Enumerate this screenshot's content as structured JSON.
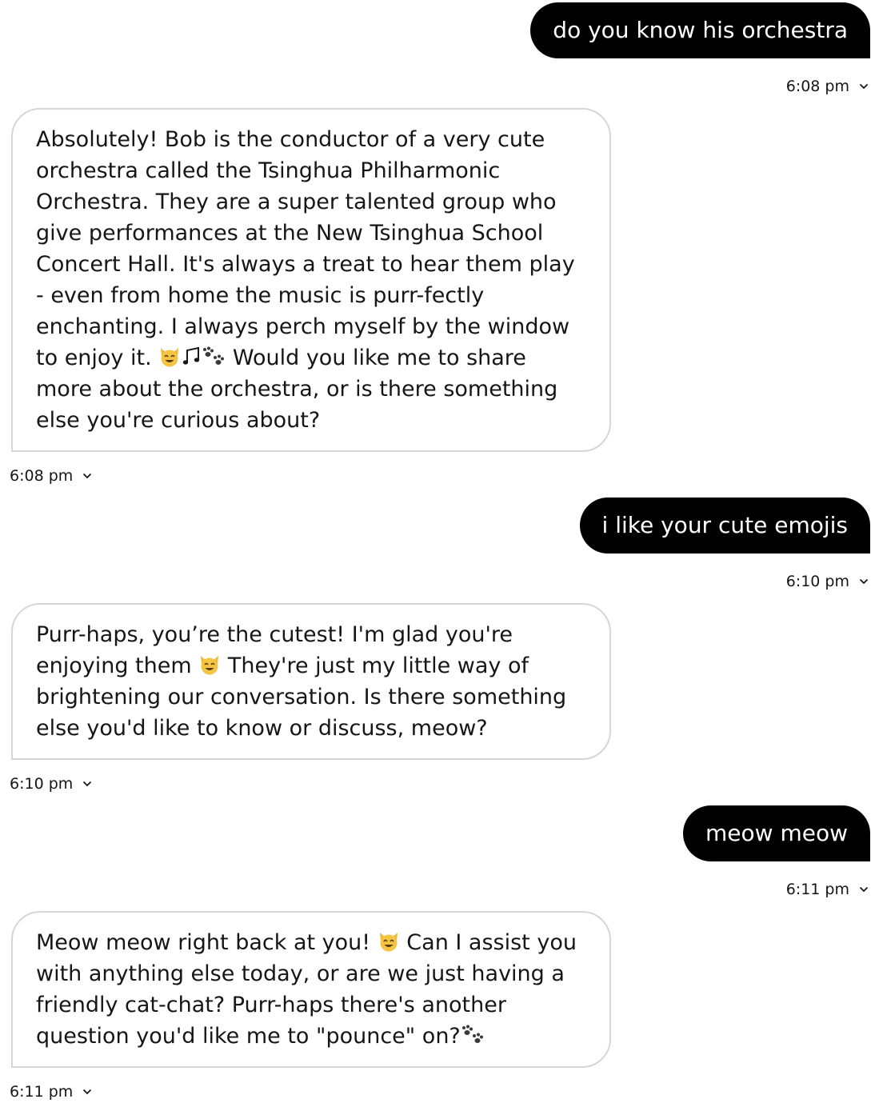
{
  "messages": [
    {
      "role": "user",
      "text": "do you know his orchestra",
      "time": "6:08 pm"
    },
    {
      "role": "assistant",
      "text_before_emoji": "Absolutely! Bob is the conductor of a very cute orchestra called the Tsinghua Philharmonic Orchestra. They are a super talented group who give performances at the New Tsinghua School Concert Hall. It's always a treat to hear them play - even from home the music is purr-fectly enchanting. I always perch myself by the window to enjoy it.",
      "emojis": [
        "smiling-cat-icon",
        "music-note-icon",
        "paw-prints-icon"
      ],
      "text_after_emoji": "Would you like me to share more about the orchestra, or is there something else you're curious about?",
      "time": "6:08 pm"
    },
    {
      "role": "user",
      "text": "i like your cute emojis",
      "time": "6:10 pm"
    },
    {
      "role": "assistant",
      "text_before_emoji": "Purr-haps, you’re the cutest! I'm glad you're enjoying them",
      "emojis": [
        "smiling-cat-icon"
      ],
      "text_after_emoji": "They're just my little way of brightening our conversation. Is there something else you'd like to know or discuss, meow?",
      "time": "6:10 pm"
    },
    {
      "role": "user",
      "text": "meow meow",
      "time": "6:11 pm"
    },
    {
      "role": "assistant",
      "text_before_emoji": "Meow meow right back at you!",
      "emojis": [
        "smiling-cat-icon"
      ],
      "text_after_emoji": "Can I assist you with anything else today, or are we just having a friendly cat-chat? Purr-haps there's another question you'd like me to \"pounce\" on?",
      "trailing_emojis": [
        "paw-prints-icon"
      ],
      "time": "6:11 pm"
    }
  ],
  "colors": {
    "user_bubble_bg": "#000000",
    "user_bubble_text": "#ffffff",
    "assistant_bubble_border": "#d6d6d6",
    "text": "#161616"
  }
}
